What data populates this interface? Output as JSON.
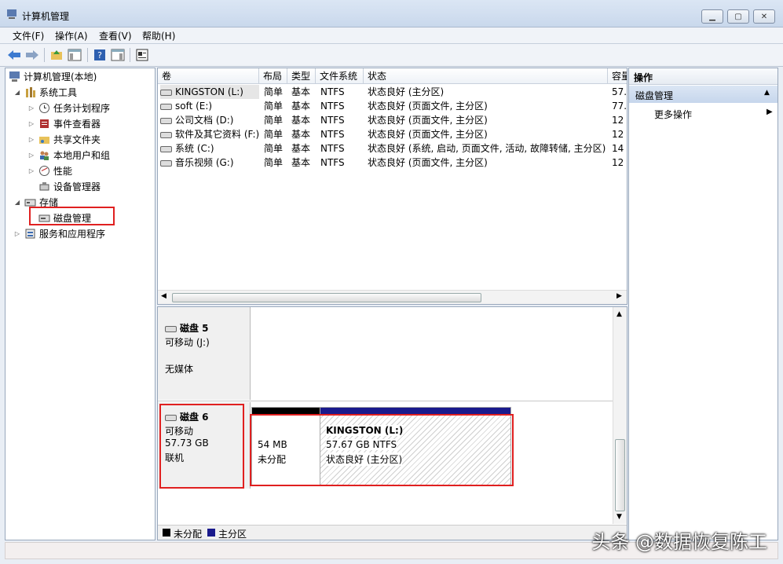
{
  "window": {
    "title": "计算机管理"
  },
  "menu": [
    "文件(F)",
    "操作(A)",
    "查看(V)",
    "帮助(H)"
  ],
  "tree": [
    {
      "label": "计算机管理(本地)",
      "icon": "computer-icon"
    },
    {
      "label": "系统工具",
      "icon": "tools-icon"
    },
    {
      "label": "任务计划程序",
      "icon": "clock-icon"
    },
    {
      "label": "事件查看器",
      "icon": "event-viewer-icon"
    },
    {
      "label": "共享文件夹",
      "icon": "shared-folder-icon"
    },
    {
      "label": "本地用户和组",
      "icon": "users-icon"
    },
    {
      "label": "性能",
      "icon": "performance-icon"
    },
    {
      "label": "设备管理器",
      "icon": "device-manager-icon"
    },
    {
      "label": "存储",
      "icon": "storage-icon"
    },
    {
      "label": "磁盘管理",
      "icon": "disk-management-icon"
    },
    {
      "label": "服务和应用程序",
      "icon": "services-icon"
    }
  ],
  "list": {
    "headers": [
      "卷",
      "布局",
      "类型",
      "文件系统",
      "状态",
      "容量"
    ],
    "rows": [
      {
        "vol": "KINGSTON (L:)",
        "layout": "简单",
        "type": "基本",
        "fs": "NTFS",
        "status": "状态良好 (主分区)",
        "cap": "57."
      },
      {
        "vol": "soft (E:)",
        "layout": "简单",
        "type": "基本",
        "fs": "NTFS",
        "status": "状态良好 (页面文件, 主分区)",
        "cap": "77."
      },
      {
        "vol": "公司文档 (D:)",
        "layout": "简单",
        "type": "基本",
        "fs": "NTFS",
        "status": "状态良好 (页面文件, 主分区)",
        "cap": "12"
      },
      {
        "vol": "软件及其它资料 (F:)",
        "layout": "简单",
        "type": "基本",
        "fs": "NTFS",
        "status": "状态良好 (页面文件, 主分区)",
        "cap": "12"
      },
      {
        "vol": "系统 (C:)",
        "layout": "简单",
        "type": "基本",
        "fs": "NTFS",
        "status": "状态良好 (系统, 启动, 页面文件, 活动, 故障转储, 主分区)",
        "cap": "14"
      },
      {
        "vol": "音乐视频 (G:)",
        "layout": "简单",
        "type": "基本",
        "fs": "NTFS",
        "status": "状态良好 (页面文件, 主分区)",
        "cap": "12"
      }
    ]
  },
  "disks": [
    {
      "name": "磁盘 5",
      "kind": "可移动 (J:)",
      "extra": "无媒体"
    },
    {
      "name": "磁盘 6",
      "kind": "可移动",
      "size": "57.73 GB",
      "state": "联机",
      "unallocated": {
        "size": "54 MB",
        "label": "未分配"
      },
      "partition": {
        "name": "KINGSTON  (L:)",
        "size": "57.67 GB NTFS",
        "status": "状态良好 (主分区)"
      }
    }
  ],
  "legend": [
    {
      "label": "未分配",
      "color": "#000000"
    },
    {
      "label": "主分区",
      "color": "#1a1a8c"
    }
  ],
  "actions": {
    "header": "操作",
    "section": "磁盘管理",
    "more": "更多操作"
  },
  "watermark": "头条 @数据恢复陈工",
  "colors": {
    "highlight": "#e02020",
    "partition_bar": "#1a1a8c",
    "unallocated_bar": "#000000"
  }
}
